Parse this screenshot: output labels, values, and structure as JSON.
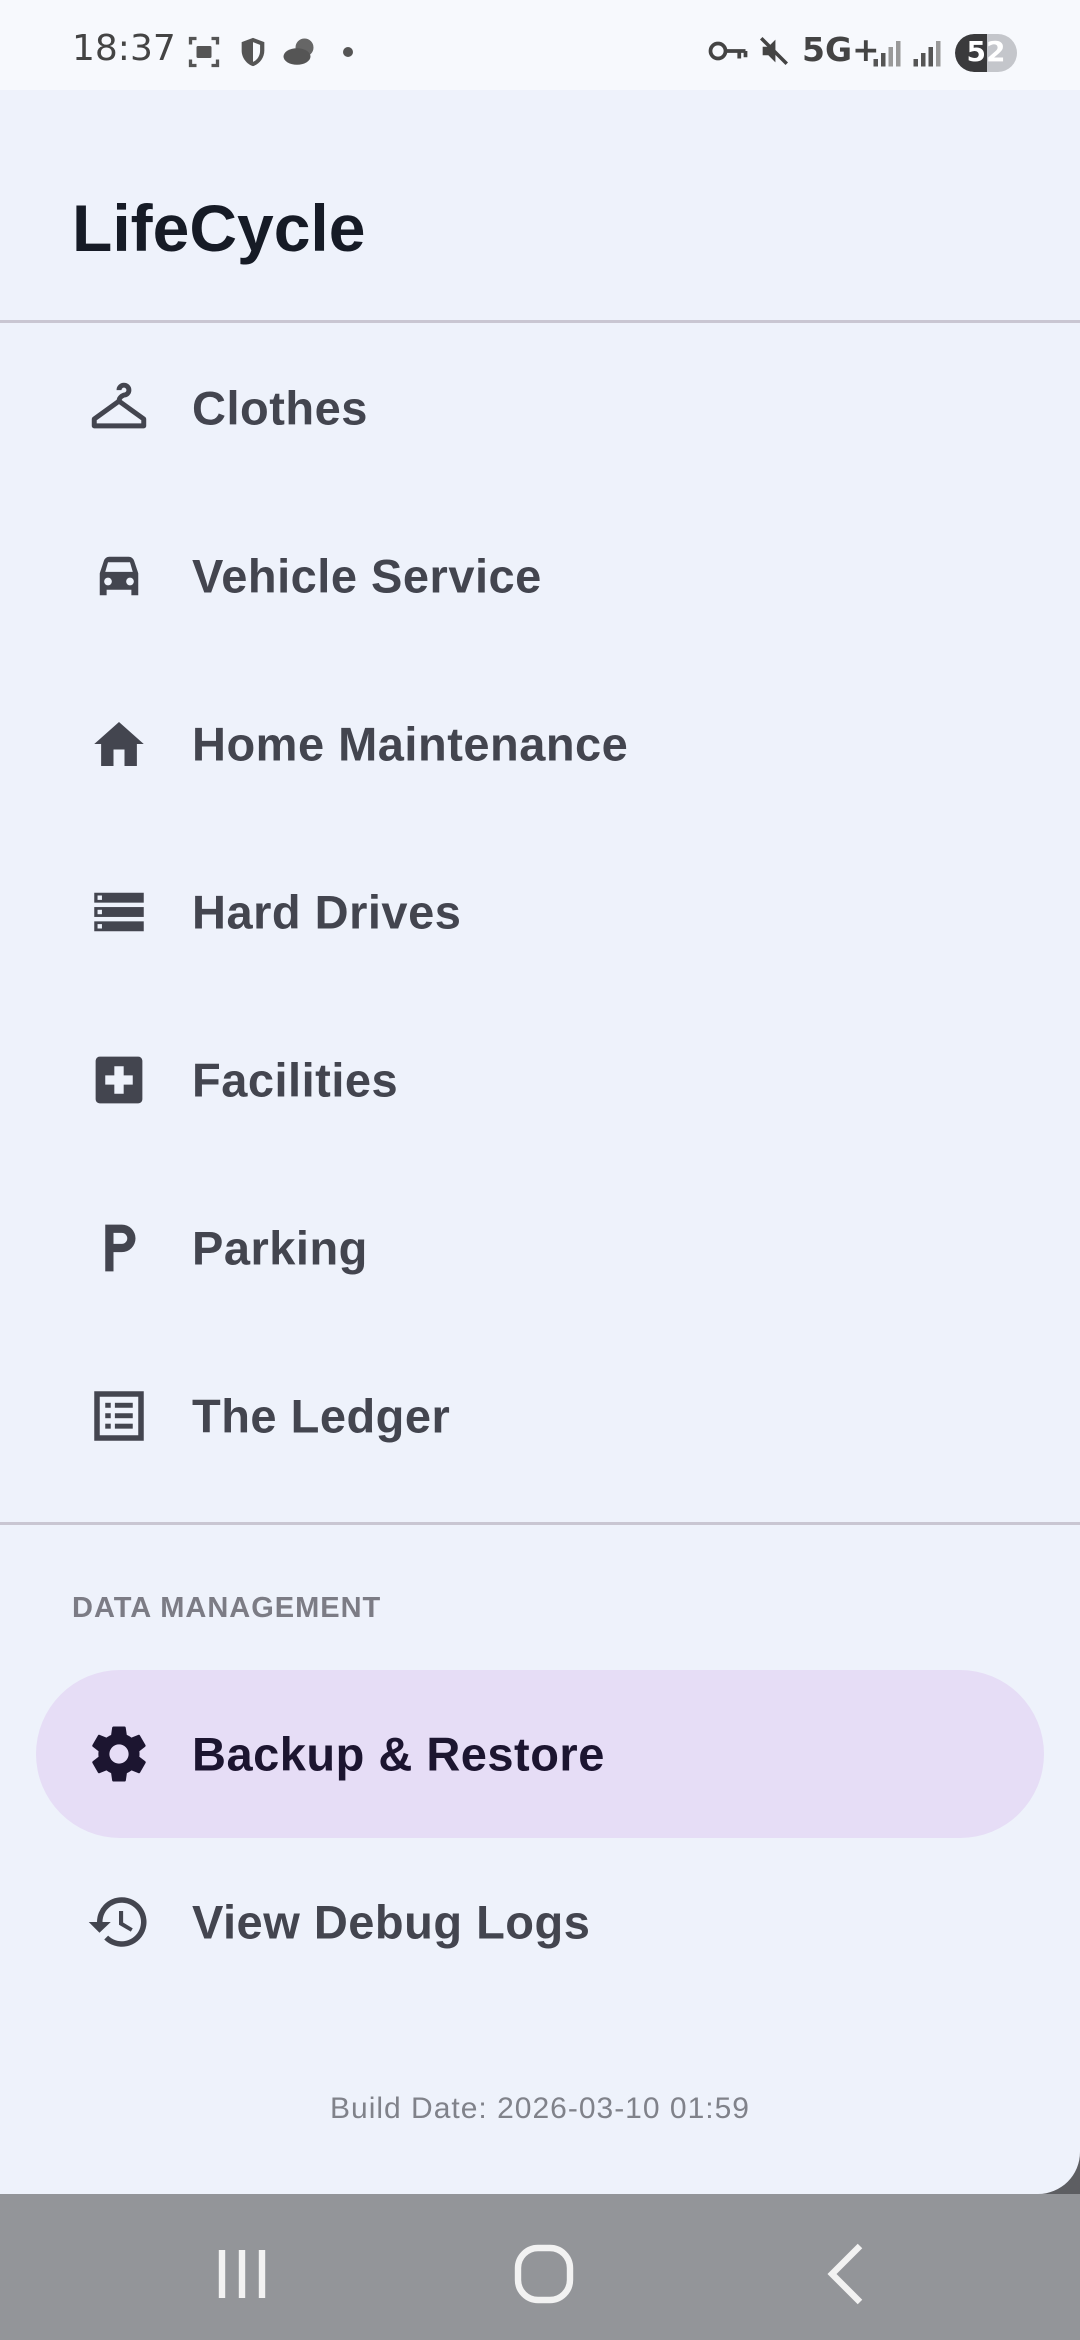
{
  "status_bar": {
    "time": "18:37",
    "network": "5G+",
    "battery": "52"
  },
  "app": {
    "title": "LifeCycle"
  },
  "nav": {
    "items": [
      {
        "label": "Clothes",
        "icon": "hanger-icon"
      },
      {
        "label": "Vehicle Service",
        "icon": "car-icon"
      },
      {
        "label": "Home Maintenance",
        "icon": "home-icon"
      },
      {
        "label": "Hard Drives",
        "icon": "storage-icon"
      },
      {
        "label": "Facilities",
        "icon": "medical-plus-icon"
      },
      {
        "label": "Parking",
        "icon": "parking-icon"
      },
      {
        "label": "The Ledger",
        "icon": "list-icon"
      }
    ]
  },
  "data_management": {
    "section_label": "DATA MANAGEMENT",
    "items": [
      {
        "label": "Backup & Restore",
        "icon": "gear-icon",
        "active": true
      },
      {
        "label": "View Debug Logs",
        "icon": "history-icon",
        "active": false
      }
    ]
  },
  "footer": {
    "build_date": "Build Date: 2026-03-10 01:59"
  },
  "colors": {
    "drawer_bg": "#eef2fb",
    "active_bg": "#e6ddf6",
    "text": "#43454f",
    "title": "#161b26"
  }
}
